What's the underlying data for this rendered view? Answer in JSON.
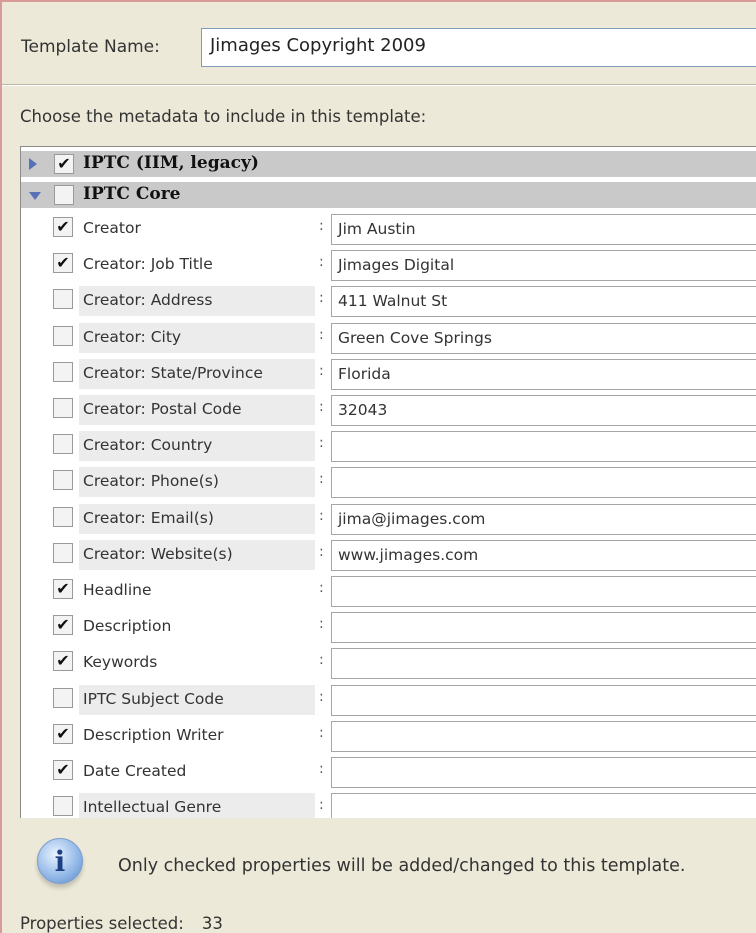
{
  "template_name": {
    "label": "Template Name:",
    "value": "Jimages Copyright 2009"
  },
  "instructions": "Choose the metadata to include in this template:",
  "groups": [
    {
      "label": "IPTC (IIM, legacy)",
      "checked": true,
      "expanded": false
    },
    {
      "label": "IPTC Core",
      "checked": false,
      "expanded": true
    }
  ],
  "properties": [
    {
      "label": "Creator",
      "checked": true,
      "value": "Jim Austin"
    },
    {
      "label": "Creator: Job Title",
      "checked": true,
      "value": "Jimages Digital"
    },
    {
      "label": "Creator: Address",
      "checked": false,
      "value": "411 Walnut St"
    },
    {
      "label": "Creator: City",
      "checked": false,
      "value": "Green Cove Springs"
    },
    {
      "label": "Creator: State/Province",
      "checked": false,
      "value": "Florida"
    },
    {
      "label": "Creator: Postal Code",
      "checked": false,
      "value": "32043"
    },
    {
      "label": "Creator: Country",
      "checked": false,
      "value": ""
    },
    {
      "label": "Creator: Phone(s)",
      "checked": false,
      "value": ""
    },
    {
      "label": "Creator: Email(s)",
      "checked": false,
      "value": "jima@jimages.com"
    },
    {
      "label": "Creator: Website(s)",
      "checked": false,
      "value": "www.jimages.com"
    },
    {
      "label": "Headline",
      "checked": true,
      "value": ""
    },
    {
      "label": "Description",
      "checked": true,
      "value": ""
    },
    {
      "label": "Keywords",
      "checked": true,
      "value": ""
    },
    {
      "label": "IPTC Subject Code",
      "checked": false,
      "value": ""
    },
    {
      "label": "Description Writer",
      "checked": true,
      "value": ""
    },
    {
      "label": "Date Created",
      "checked": true,
      "value": ""
    },
    {
      "label": "Intellectual Genre",
      "checked": false,
      "value": ""
    }
  ],
  "info": {
    "icon": "info-icon",
    "text": "Only checked properties will be added/changed to this template."
  },
  "status": {
    "label": "Properties selected:",
    "count": "33"
  },
  "colors": {
    "group_bg": "#c9c9c9",
    "triangle": "#5870b8",
    "window_bg": "#ece9d8"
  }
}
